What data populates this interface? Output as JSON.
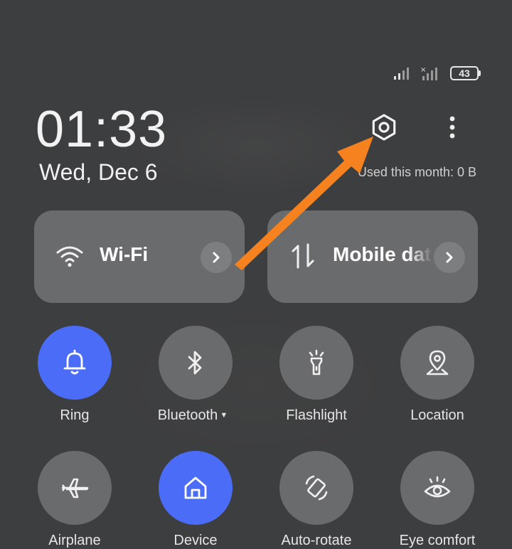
{
  "status": {
    "battery": "43",
    "signal_icon": "cellular-signal-icon",
    "no_signal_icon": "no-signal-icon"
  },
  "clock": {
    "time": "01:33",
    "date": "Wed, Dec 6"
  },
  "data_usage": "Used this month: 0 B",
  "header_actions": {
    "settings_icon": "gear-icon",
    "more_icon": "more-vertical-icon"
  },
  "tiles": [
    {
      "label": "Wi-Fi",
      "icon": "wifi-icon"
    },
    {
      "label": "Mobile data",
      "icon": "mobile-data-icon"
    }
  ],
  "toggles": [
    {
      "label": "Ring",
      "icon": "bell-icon",
      "active": true
    },
    {
      "label": "Bluetooth",
      "icon": "bluetooth-icon",
      "active": false
    },
    {
      "label": "Flashlight",
      "icon": "flashlight-icon",
      "active": false
    },
    {
      "label": "Location",
      "icon": "location-icon",
      "active": false
    },
    {
      "label": "Airplane",
      "icon": "airplane-icon",
      "active": false
    },
    {
      "label": "Device",
      "icon": "home-icon",
      "active": true
    },
    {
      "label": "Auto-rotate",
      "icon": "auto-rotate-icon",
      "active": false
    },
    {
      "label": "Eye comfort",
      "icon": "eye-icon",
      "active": false
    }
  ],
  "colors": {
    "background": "#3d3e3f",
    "tile": "#6a6b6c",
    "active_accent": "#4a6cf7",
    "annotation_arrow": "#f5821f"
  }
}
